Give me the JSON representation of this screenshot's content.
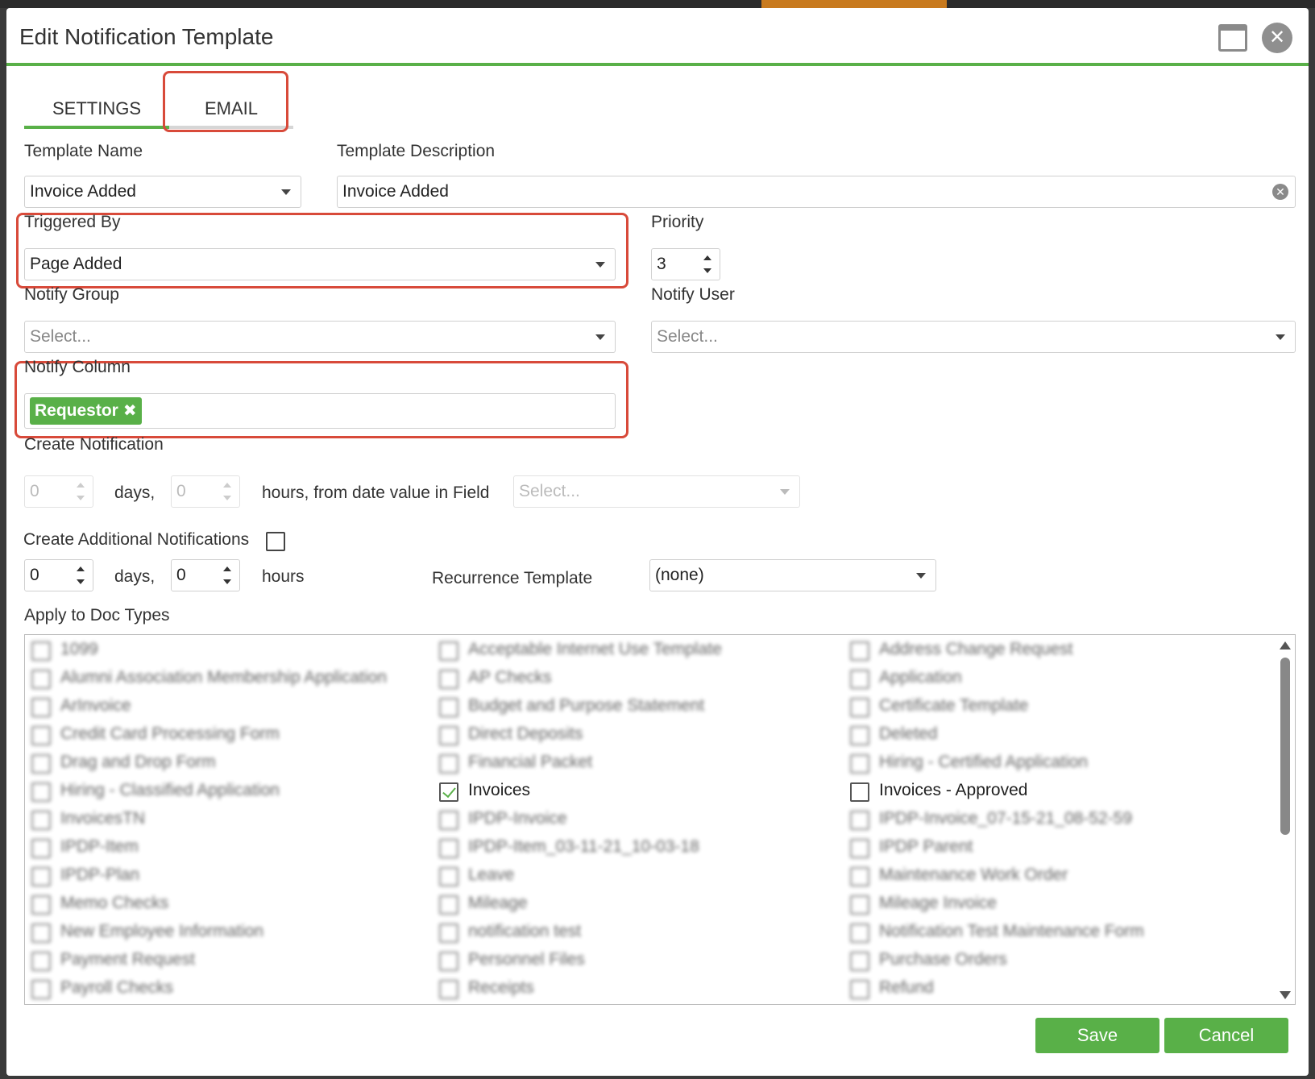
{
  "dialog": {
    "title": "Edit Notification Template"
  },
  "tabs": [
    {
      "label": "SETTINGS"
    },
    {
      "label": "EMAIL"
    }
  ],
  "form": {
    "template_name_label": "Template Name",
    "template_name_value": "Invoice Added",
    "template_description_label": "Template Description",
    "template_description_value": "Invoice Added",
    "triggered_by_label": "Triggered By",
    "triggered_by_value": "Page Added",
    "priority_label": "Priority",
    "priority_value": "3",
    "notify_group_label": "Notify Group",
    "notify_group_placeholder": "Select...",
    "notify_user_label": "Notify User",
    "notify_user_placeholder": "Select...",
    "notify_column_label": "Notify Column",
    "notify_column_tag": "Requestor",
    "create_notification_label": "Create Notification",
    "create_days_value": "0",
    "create_days_text": "days,",
    "create_hours_value": "0",
    "create_hours_text": "hours, from date value in Field",
    "create_field_placeholder": "Select...",
    "additional_label": "Create Additional Notifications",
    "add_days_value": "0",
    "add_days_text": "days,",
    "add_hours_value": "0",
    "add_hours_text": "hours",
    "recurrence_label": "Recurrence Template",
    "recurrence_value": "(none)",
    "doc_types_label": "Apply to Doc Types"
  },
  "doc_types": [
    [
      "1099",
      "Acceptable Internet Use Template",
      "Address Change Request"
    ],
    [
      "Alumni Association Membership Application",
      "AP Checks",
      "Application"
    ],
    [
      "ArInvoice",
      "Budget and Purpose Statement",
      "Certificate Template"
    ],
    [
      "Credit Card Processing Form",
      "Direct Deposits",
      "Deleted"
    ],
    [
      "Drag and Drop Form",
      "Financial Packet",
      "Hiring - Certified Application"
    ],
    [
      "Hiring - Classified Application",
      "Invoices",
      "Invoices - Approved"
    ],
    [
      "InvoicesTN",
      "IPDP-Invoice",
      "IPDP-Invoice_07-15-21_08-52-59"
    ],
    [
      "IPDP-Item",
      "IPDP-Item_03-11-21_10-03-18",
      "IPDP Parent"
    ],
    [
      "IPDP-Plan",
      "Leave",
      "Maintenance Work Order"
    ],
    [
      "Memo Checks",
      "Mileage",
      "Mileage Invoice"
    ],
    [
      "New Employee Information",
      "notification test",
      "Notification Test Maintenance Form"
    ],
    [
      "Payment Request",
      "Personnel Files",
      "Purchase Orders"
    ],
    [
      "Payroll Checks",
      "Receipts",
      "Refund"
    ]
  ],
  "doc_types_checked": [
    "Invoices"
  ],
  "doc_types_visible": [
    "Invoices",
    "Invoices - Approved"
  ],
  "buttons": {
    "save": "Save",
    "cancel": "Cancel"
  },
  "colors": {
    "accent": "#59b048",
    "highlight": "#d84a3a"
  }
}
